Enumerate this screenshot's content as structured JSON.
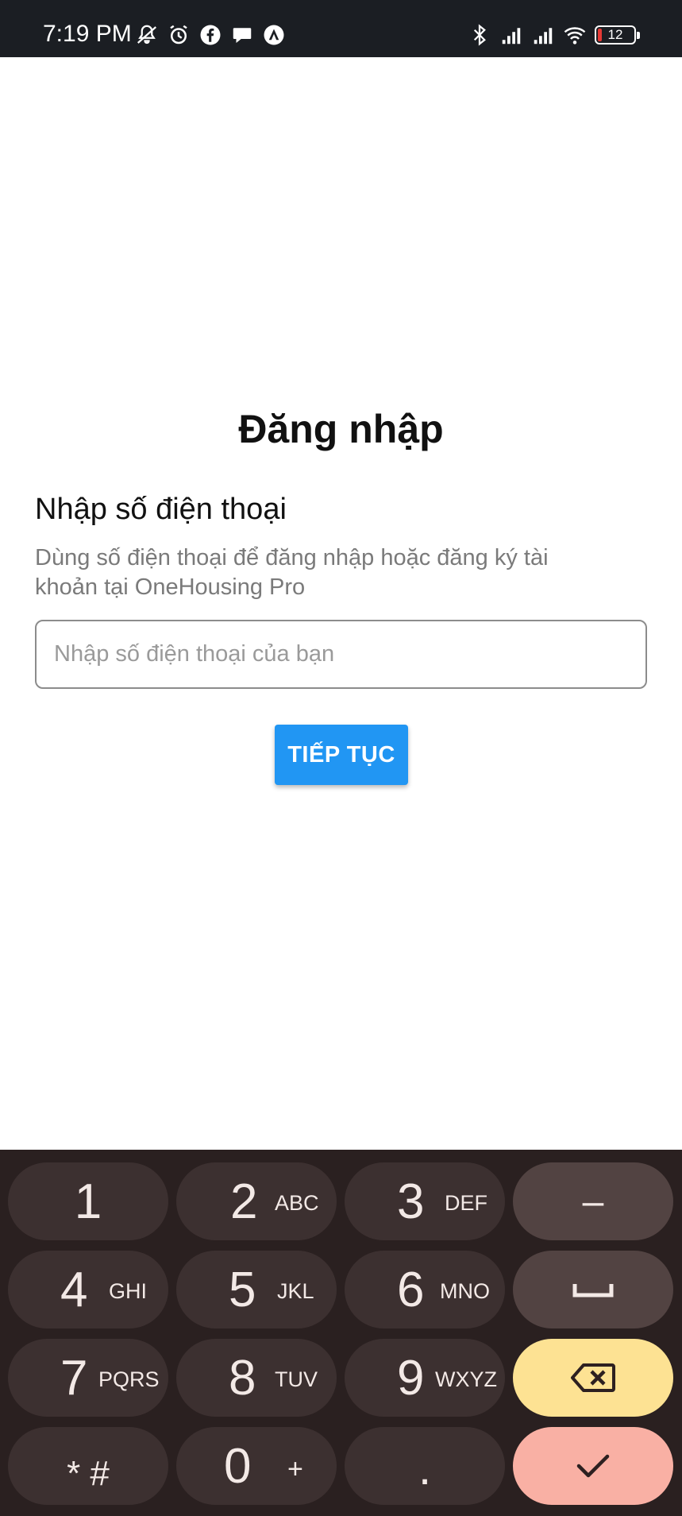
{
  "status_bar": {
    "time": "7:19 PM",
    "battery_level": "12",
    "left_icons": [
      "mute-icon",
      "alarm-icon",
      "facebook-icon",
      "chat-icon",
      "app-icon"
    ],
    "right_icons": [
      "bluetooth-icon",
      "signal-icon",
      "signal-icon",
      "wifi-icon",
      "battery-icon"
    ]
  },
  "main": {
    "title": "Đăng nhập",
    "heading": "Nhập số điện thoại",
    "description": "Dùng số điện thoại để đăng nhập hoặc đăng ký tài khoản tại OneHousing Pro",
    "phone_input": {
      "placeholder": "Nhập số điện thoại của bạn",
      "value": ""
    },
    "continue_label": "TIẾP TỤC"
  },
  "colors": {
    "accent": "#2196f3",
    "keyboard_bg": "#2a2020",
    "key_bg": "#3c3030",
    "backspace_bg": "#fde293",
    "enter_bg": "#f9b0a4"
  },
  "keyboard": {
    "k1": {
      "digit": "1",
      "letters": ""
    },
    "k2": {
      "digit": "2",
      "letters": "ABC"
    },
    "k3": {
      "digit": "3",
      "letters": "DEF"
    },
    "k4": {
      "digit": "4",
      "letters": "GHI"
    },
    "k5": {
      "digit": "5",
      "letters": "JKL"
    },
    "k6": {
      "digit": "6",
      "letters": "MNO"
    },
    "k7": {
      "digit": "7",
      "letters": "PQRS"
    },
    "k8": {
      "digit": "8",
      "letters": "TUV"
    },
    "k9": {
      "digit": "9",
      "letters": "WXYZ"
    },
    "k0": {
      "digit": "0",
      "letters": "+"
    },
    "star_hash": "* #",
    "dot": ".",
    "minus": "–",
    "space_icon": "space-icon",
    "backspace_icon": "backspace-icon",
    "enter_icon": "check-icon"
  }
}
